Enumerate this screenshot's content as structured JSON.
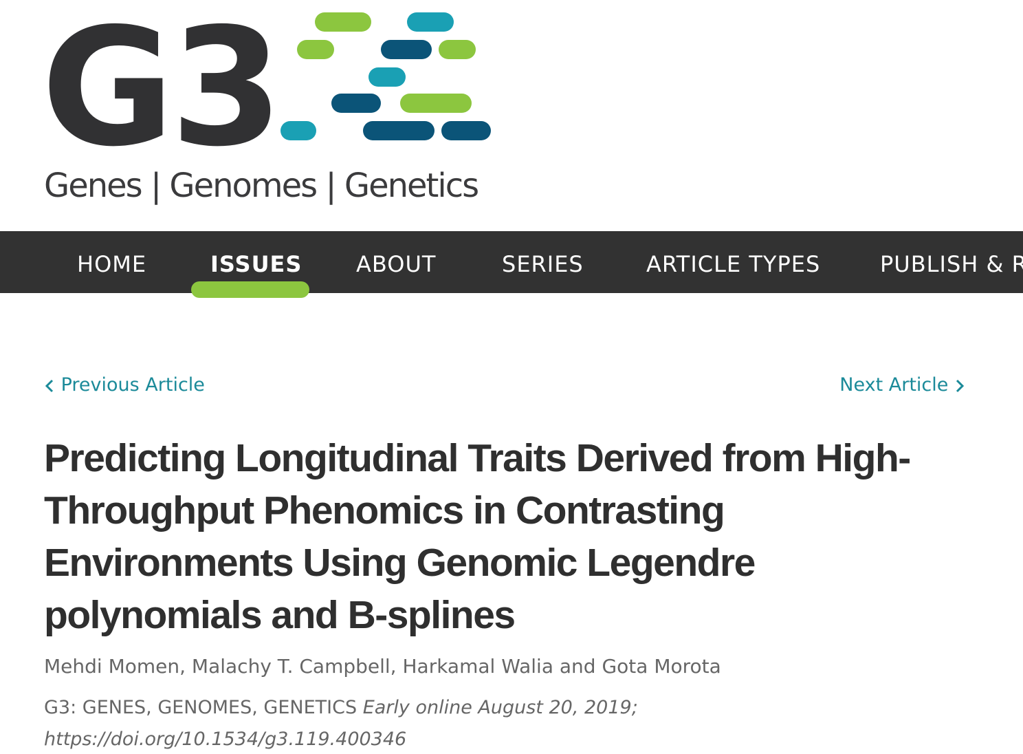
{
  "branding": {
    "logo_text": "G3",
    "tagline": "Genes | Genomes | Genetics",
    "colors": {
      "dark": "#313133",
      "green": "#8cc63f",
      "teal": "#1aa0b4",
      "navy": "#0b5478"
    }
  },
  "nav": {
    "items": [
      {
        "label": "HOME"
      },
      {
        "label": "ISSUES"
      },
      {
        "label": "ABOUT"
      },
      {
        "label": "SERIES"
      },
      {
        "label": "ARTICLE TYPES"
      },
      {
        "label": "PUBLISH & RE"
      }
    ],
    "active": "ISSUES"
  },
  "article_nav": {
    "previous_label": "Previous Article",
    "next_label": "Next Article"
  },
  "article": {
    "title": "Predicting Longitudinal Traits Derived from High-Throughput Phenomics in Contrasting Environments Using Genomic Legendre polynomials and B-splines",
    "authors": "Mehdi Momen, Malachy T. Campbell, Harkamal Walia and Gota Morota",
    "journal": "G3: GENES, GENOMES, GENETICS",
    "date": "Early online August 20, 2019;",
    "doi": "https://doi.org/10.1534/g3.119.400346"
  }
}
